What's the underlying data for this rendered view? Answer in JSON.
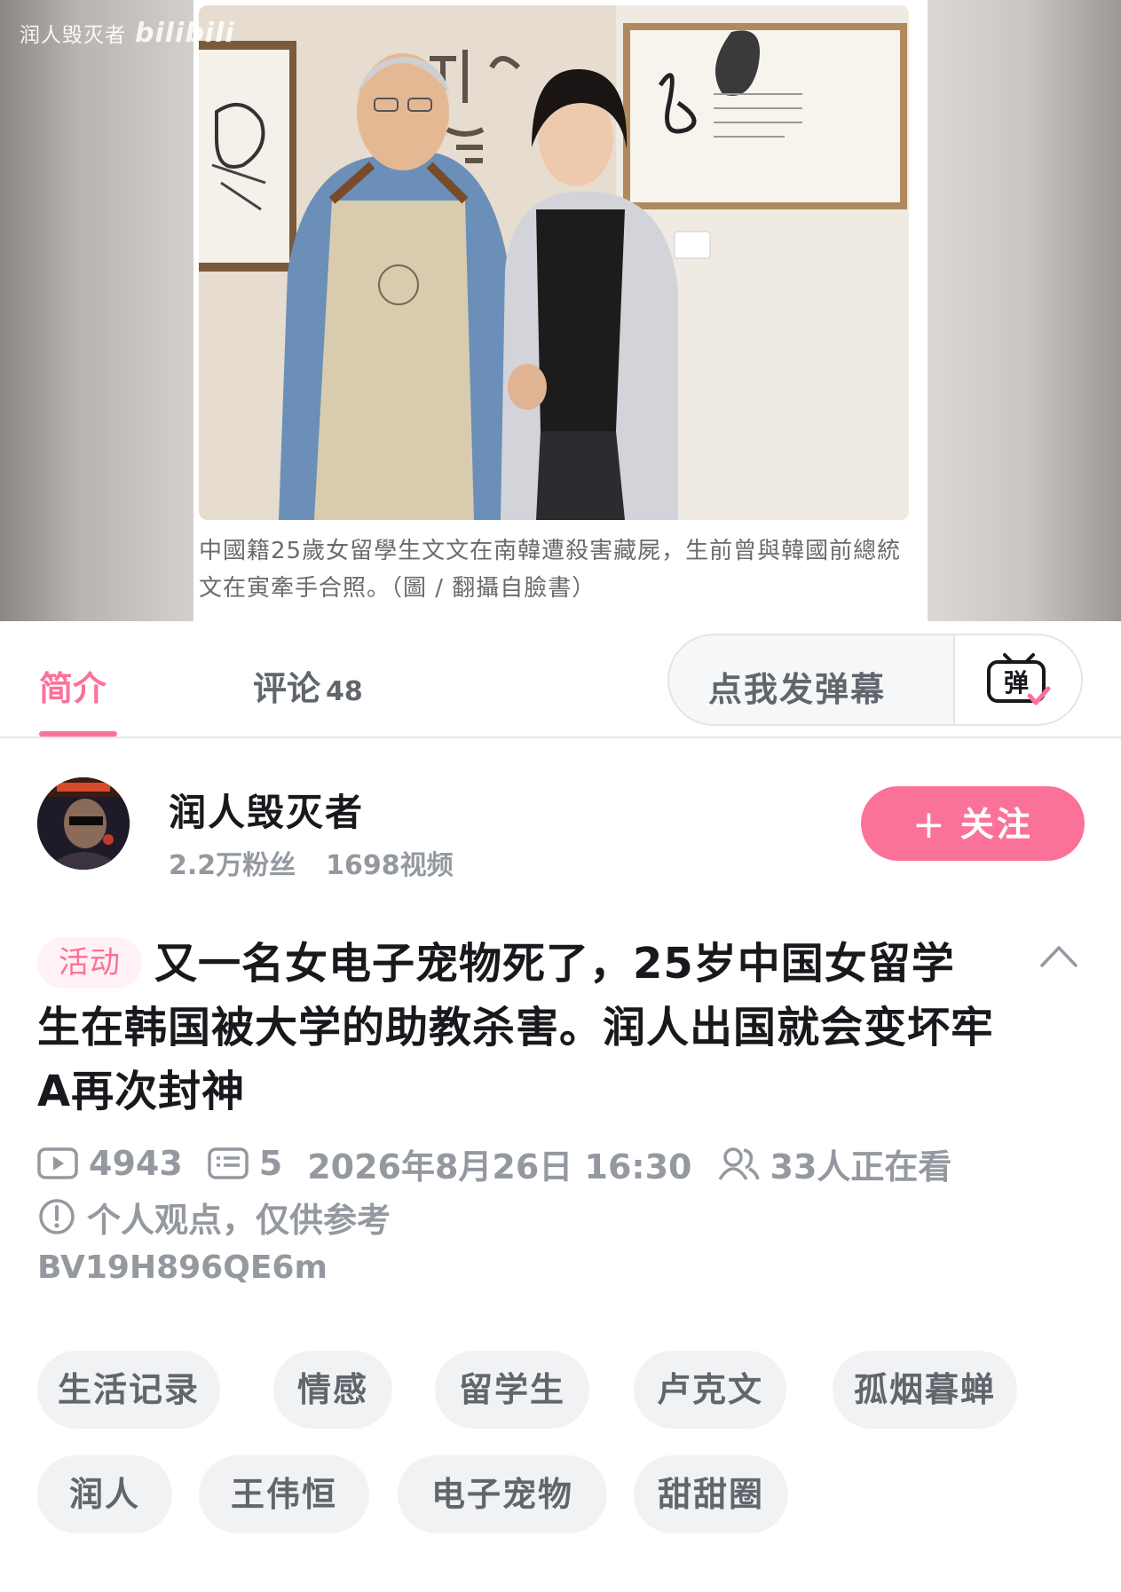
{
  "video": {
    "watermark_channel": "润人毁灭者",
    "watermark_logo": "bilibili",
    "caption": "中國籍25歲女留學生文文在南韓遭殺害藏屍，生前曾與韓國前總統文在寅牽手合照。（圖 / 翻攝自臉書）"
  },
  "tabs": {
    "intro_label": "简介",
    "comments_label": "评论",
    "comments_count": "48"
  },
  "danmaku": {
    "placeholder": "点我发弹幕",
    "button_glyph": "弹"
  },
  "uploader": {
    "name": "润人毁灭者",
    "fans": "2.2万粉丝",
    "videos": "1698视频",
    "follow_label": "关注"
  },
  "title": {
    "badge": "活动",
    "text": "又一名女电子宠物死了，25岁中国女留学生在韩国被大学的助教杀害。润人出国就会变坏牢A再次封神"
  },
  "meta": {
    "views": "4943",
    "danmaku_count": "5",
    "datetime": "2026年8月26日 16:30",
    "watching": "33人正在看",
    "notice": "个人观点，仅供参考",
    "bvid": "BV19H896QE6m"
  },
  "tags": [
    "生活记录",
    "情感",
    "留学生",
    "卢克文",
    "孤烟暮蝉",
    "润人",
    "王伟恒",
    "电子宠物",
    "甜甜圈"
  ],
  "colors": {
    "accent": "#fb7299",
    "text_primary": "#18191c",
    "text_secondary": "#61666d",
    "text_muted": "#9499a0",
    "tag_bg": "#f1f2f3"
  }
}
